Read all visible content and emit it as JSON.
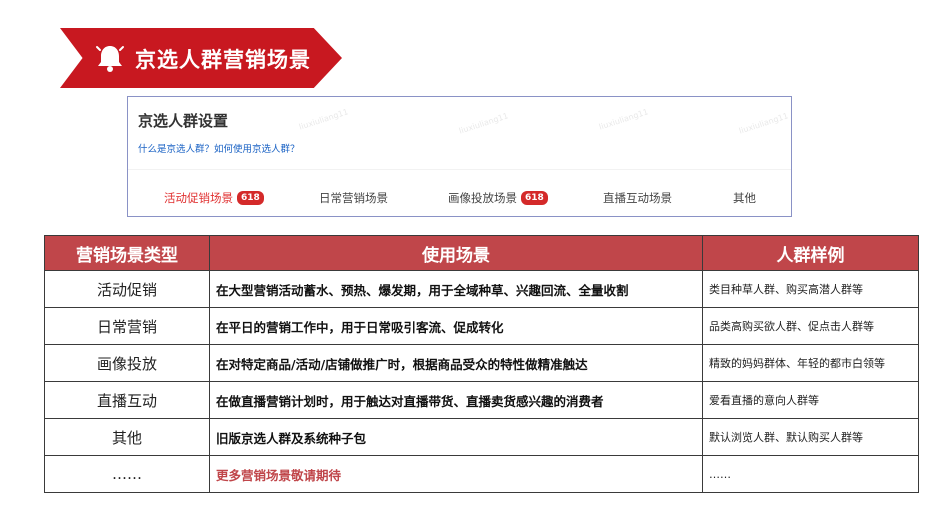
{
  "banner": {
    "title": "京选人群营销场景"
  },
  "settings": {
    "title": "京选人群设置",
    "help_link_1": "什么是京选人群？",
    "help_link_2": "如何使用京选人群？",
    "tabs": [
      {
        "label": "活动促销场景",
        "badge": "618",
        "active": true
      },
      {
        "label": "日常营销场景",
        "badge": "",
        "active": false
      },
      {
        "label": "画像投放场景",
        "badge": "618",
        "active": false
      },
      {
        "label": "直播互动场景",
        "badge": "",
        "active": false
      },
      {
        "label": "其他",
        "badge": "",
        "active": false
      }
    ],
    "watermark": "liuxiuliang11"
  },
  "table": {
    "headers": [
      "营销场景类型",
      "使用场景",
      "人群样例"
    ],
    "rows": [
      {
        "type": "活动促销",
        "usage": "在大型营销活动蓄水、预热、爆发期，用于全域种草、兴趣回流、全量收割",
        "example": "类目种草人群、购买高潜人群等"
      },
      {
        "type": "日常营销",
        "usage": "在平日的营销工作中，用于日常吸引客流、促成转化",
        "example": "品类高购买欲人群、促点击人群等"
      },
      {
        "type": "画像投放",
        "usage": "在对特定商品/活动/店铺做推广时，根据商品受众的特性做精准触达",
        "example": "精致的妈妈群体、年轻的都市白领等"
      },
      {
        "type": "直播互动",
        "usage": "在做直播营销计划时，用于触达对直播带货、直播卖货感兴趣的消费者",
        "example": "爱看直播的意向人群等"
      },
      {
        "type": "其他",
        "usage": "旧版京选人群及系统种子包",
        "example": "默认浏览人群、默认购买人群等"
      },
      {
        "type": "……",
        "usage": "更多营销场景敬请期待",
        "example": "……"
      }
    ]
  },
  "colors": {
    "banner_red": "#c81820",
    "header_red": "#c0464a",
    "active_tab": "#e03030",
    "link_blue": "#1a62c4"
  },
  "icons": {
    "banner": "bell-icon"
  }
}
